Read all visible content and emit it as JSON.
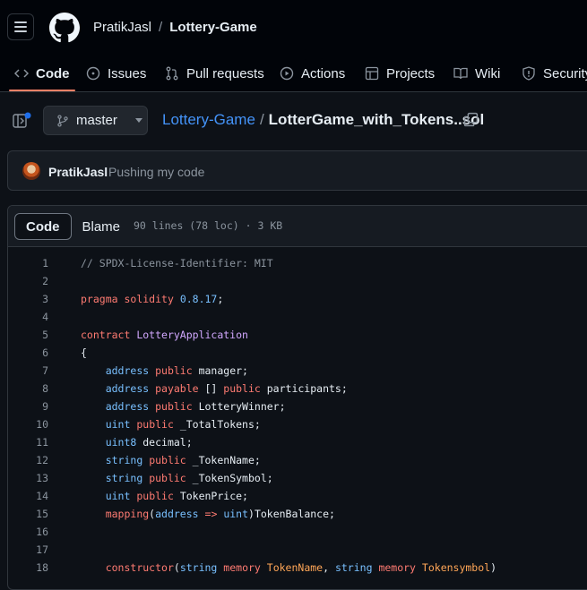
{
  "header": {
    "owner": "PratikJasl",
    "separator": "/",
    "repo": "Lottery-Game"
  },
  "tabs": [
    {
      "label": "Code",
      "icon": "code-icon",
      "active": true
    },
    {
      "label": "Issues",
      "icon": "issue-opened-icon"
    },
    {
      "label": "Pull requests",
      "icon": "git-pull-request-icon"
    },
    {
      "label": "Actions",
      "icon": "play-icon"
    },
    {
      "label": "Projects",
      "icon": "table-icon"
    },
    {
      "label": "Wiki",
      "icon": "book-icon"
    },
    {
      "label": "Security",
      "icon": "shield-icon"
    }
  ],
  "file": {
    "branch": "master",
    "repo_link": "Lottery-Game",
    "separator": "/",
    "filename": "LotterGame_with_Tokens..sol"
  },
  "commit": {
    "author": "PratikJasl",
    "message": "Pushing my code"
  },
  "viewer": {
    "code_tab": "Code",
    "blame_tab": "Blame",
    "meta": "90 lines (78 loc) · 3 KB"
  },
  "code_lines": [
    {
      "n": "1",
      "text": "// SPDX-License-Identifier: MIT"
    },
    {
      "n": "2",
      "text": ""
    },
    {
      "n": "3",
      "text": "pragma solidity 0.8.17;"
    },
    {
      "n": "4",
      "text": ""
    },
    {
      "n": "5",
      "text": "contract LotteryApplication"
    },
    {
      "n": "6",
      "text": "{"
    },
    {
      "n": "7",
      "text": "    address public manager;"
    },
    {
      "n": "8",
      "text": "    address payable [] public participants;"
    },
    {
      "n": "9",
      "text": "    address public LotteryWinner;"
    },
    {
      "n": "10",
      "text": "    uint public _TotalTokens;"
    },
    {
      "n": "11",
      "text": "    uint8 decimal;"
    },
    {
      "n": "12",
      "text": "    string public _TokenName;"
    },
    {
      "n": "13",
      "text": "    string public _TokenSymbol;"
    },
    {
      "n": "14",
      "text": "    uint public TokenPrice;"
    },
    {
      "n": "15",
      "text": "    mapping(address => uint)TokenBalance;"
    },
    {
      "n": "16",
      "text": ""
    },
    {
      "n": "17",
      "text": ""
    },
    {
      "n": "18",
      "text": "    constructor(string memory TokenName, string memory Tokensymbol)"
    }
  ],
  "colors": {
    "keyword": "#ff7b72",
    "type": "#79c0ff",
    "entity": "#d2a8ff",
    "comment": "#8b949e",
    "param": "#ffa657",
    "link": "#4493f8",
    "tab_underline": "#f78166"
  }
}
